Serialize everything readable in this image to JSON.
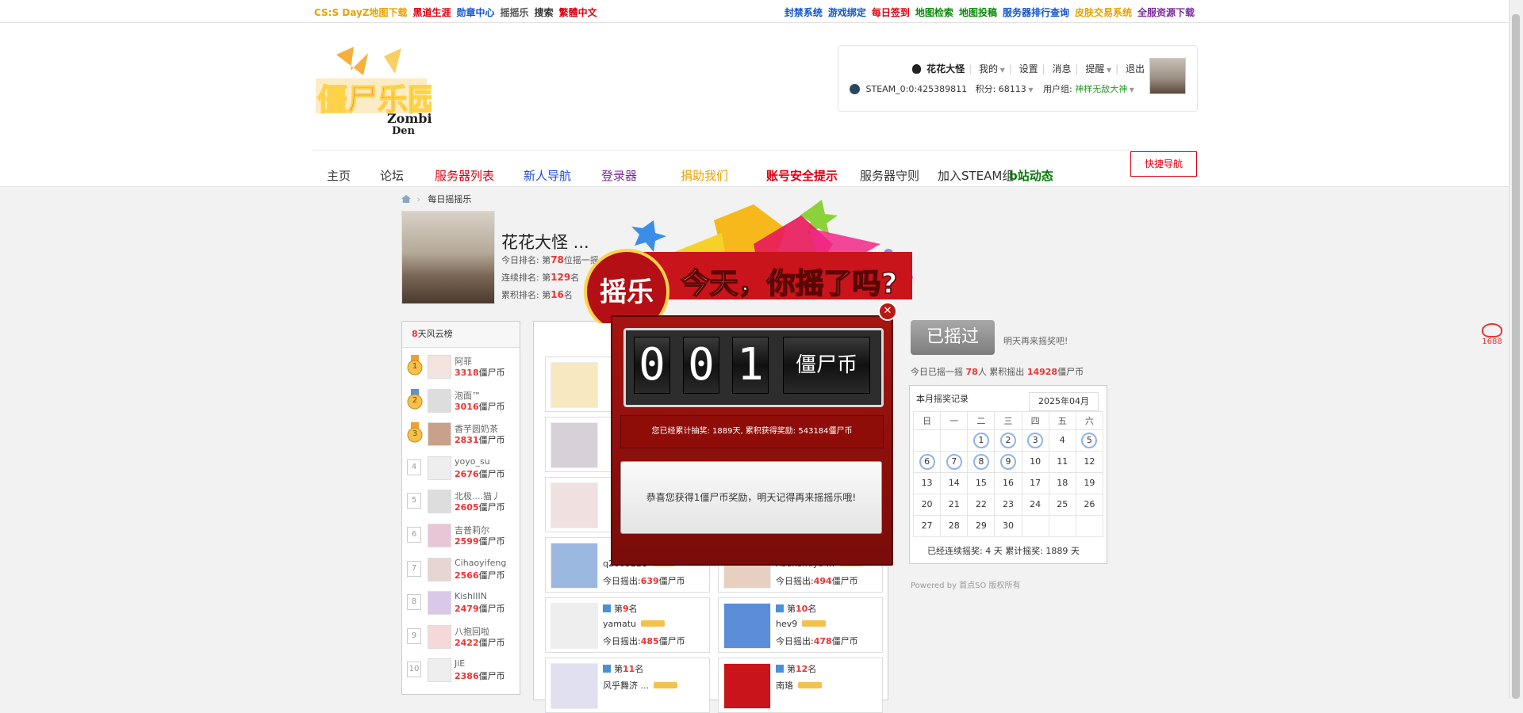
{
  "topbar": {
    "left": [
      {
        "label": "CS:S DayZ地图下载",
        "color": "#e8a100"
      },
      {
        "label": "黑道生涯",
        "color": "#d01"
      },
      {
        "label": "勋章中心",
        "color": "#1155cc"
      },
      {
        "label": "摇摇乐",
        "color": "#555"
      },
      {
        "label": "搜索",
        "color": "#333"
      },
      {
        "label": "繁體中文",
        "color": "#d01"
      }
    ],
    "right": [
      {
        "label": "封禁系统",
        "color": "#1155cc"
      },
      {
        "label": "游戏绑定",
        "color": "#1155cc"
      },
      {
        "label": "每日签到",
        "color": "#d01"
      },
      {
        "label": "地图检索",
        "color": "#0a8a0a"
      },
      {
        "label": "地图投稿",
        "color": "#0a8a0a"
      },
      {
        "label": "服务器排行查询",
        "color": "#1155cc"
      },
      {
        "label": "皮肤交易系统",
        "color": "#e8a100"
      },
      {
        "label": "全服资源下载",
        "color": "#7b2c9e"
      }
    ]
  },
  "logo": {
    "main": "僵尸乐园",
    "sub1": "Zombie",
    "sub2": "Den"
  },
  "user": {
    "name": "花花大怪",
    "my": "我的",
    "settings": "设置",
    "messages": "消息",
    "remind": "提醒",
    "logout": "退出",
    "steam": "STEAM_0:0:425389811",
    "points_label": "积分:",
    "points": "68113",
    "group_label": "用户组:",
    "group": "神样无敌大神"
  },
  "nav": [
    {
      "label": "主页",
      "color": "#333"
    },
    {
      "label": "论坛",
      "color": "#333"
    },
    {
      "label": "服务器列表",
      "color": "#d01"
    },
    {
      "label": "新人导航",
      "color": "#1d4fd6"
    },
    {
      "label": "登录器",
      "color": "#7b2c9e"
    },
    {
      "label": "捐助我们",
      "color": "#e8a100"
    },
    {
      "label": "账号安全提示",
      "color": "#d01"
    },
    {
      "label": "服务器守则",
      "color": "#333"
    },
    {
      "label": "加入STEAM组",
      "color": "#333"
    },
    {
      "label": "b站动态",
      "color": "#0a7a0a"
    }
  ],
  "quick_nav": "快捷导航",
  "breadcrumb": "每日摇摇乐",
  "profile": {
    "name": "花花大怪 ...",
    "line1_pre": "今日排名: 第",
    "line1_num": "78",
    "line1_post": "位摇一摇 获得1僵尸币，共各76",
    "line2_pre": "连续排名: 第",
    "line2_num": "129",
    "line2_post": "名",
    "line3_pre": "累积排名: 第",
    "line3_num": "16",
    "line3_post": "名"
  },
  "leaderboard": {
    "title_num": "8",
    "title": "天风云榜",
    "unit": "僵尸币",
    "items": [
      {
        "rank": "1",
        "name": "阿菲",
        "value": "3318"
      },
      {
        "rank": "2",
        "name": "泡面™",
        "value": "3016"
      },
      {
        "rank": "3",
        "name": "香芋圆奶茶",
        "value": "2831"
      },
      {
        "rank": "4",
        "name": "yoyo_su",
        "value": "2676"
      },
      {
        "rank": "5",
        "name": "北极....猫丿",
        "value": "2605"
      },
      {
        "rank": "6",
        "name": "吉普莉尔",
        "value": "2599"
      },
      {
        "rank": "7",
        "name": "Cihaoyifeng",
        "value": "2566"
      },
      {
        "rank": "8",
        "name": "KishIIIN",
        "value": "2479"
      },
      {
        "rank": "9",
        "name": "八抱回啦",
        "value": "2422"
      },
      {
        "rank": "10",
        "name": "JiE",
        "value": "2386"
      }
    ]
  },
  "cards": {
    "rank_pre": "第",
    "rank_post": "名",
    "today": "今日摇出:",
    "unit": "僵尸币",
    "items": [
      {
        "rank": "",
        "name": "",
        "value": ""
      },
      {
        "rank": "",
        "name": "",
        "value": ""
      },
      {
        "rank": "",
        "name": "",
        "value": ""
      },
      {
        "rank": "",
        "name": "",
        "value": ""
      },
      {
        "rank": "",
        "name": "",
        "value": ""
      },
      {
        "rank": "",
        "name": "",
        "value": ""
      },
      {
        "rank": "",
        "name": "q2005221",
        "value": "639"
      },
      {
        "rank": "",
        "name": "Asuka.Kiyo ...",
        "value": "494"
      },
      {
        "rank": "9",
        "name": "yamatu",
        "value": "485"
      },
      {
        "rank": "10",
        "name": "hev9",
        "value": "478"
      },
      {
        "rank": "11",
        "name": "风乎舞济 ...",
        "value": ""
      },
      {
        "rank": "12",
        "name": "南珞",
        "value": ""
      }
    ]
  },
  "shake": {
    "button": "已摇过",
    "tomorrow": "明天再来摇奖吧!",
    "today_pre": "今日已摇一摇",
    "today_count": "78",
    "today_mid": "人 累积摇出",
    "today_total": "14928",
    "today_unit": "僵尸币"
  },
  "calendar": {
    "title": "本月摇奖记录",
    "month": "2025年04月",
    "weekdays": [
      "日",
      "一",
      "二",
      "三",
      "四",
      "五",
      "六"
    ],
    "footer": "已经连续摇奖:  4 天 累计摇奖:  1889 天"
  },
  "powered": "Powered by 首点SO 版权所有",
  "modal": {
    "banner_badge": "摇乐",
    "banner_title": "今天，你摇了吗?",
    "digits": [
      "0",
      "0",
      "1"
    ],
    "unit": "僵尸币",
    "summary": "您已经累计抽奖: 1889天, 累积获得奖励: 543184僵尸币",
    "message": "恭喜您获得1僵尸币奖励，明天记得再来摇摇乐哦!"
  },
  "side": "1688"
}
